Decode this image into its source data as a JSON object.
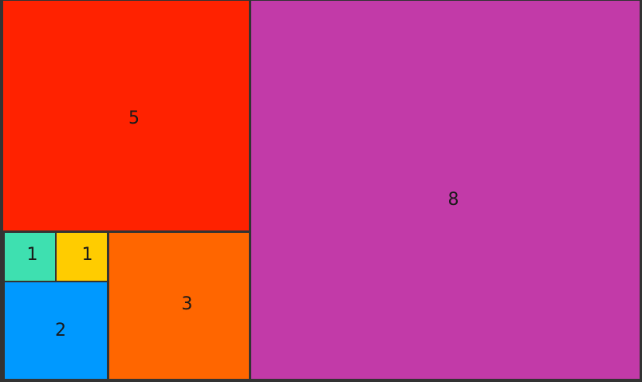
{
  "tiles": [
    {
      "id": "tile-5",
      "label": "5",
      "color": "#ff2200"
    },
    {
      "id": "tile-8",
      "label": "8",
      "color": "#c23aa8"
    },
    {
      "id": "tile-1a",
      "label": "1",
      "color": "#3ee0b0"
    },
    {
      "id": "tile-1b",
      "label": "1",
      "color": "#ffcc00"
    },
    {
      "id": "tile-2",
      "label": "2",
      "color": "#0099ff"
    },
    {
      "id": "tile-3",
      "label": "3",
      "color": "#ff6600"
    }
  ]
}
